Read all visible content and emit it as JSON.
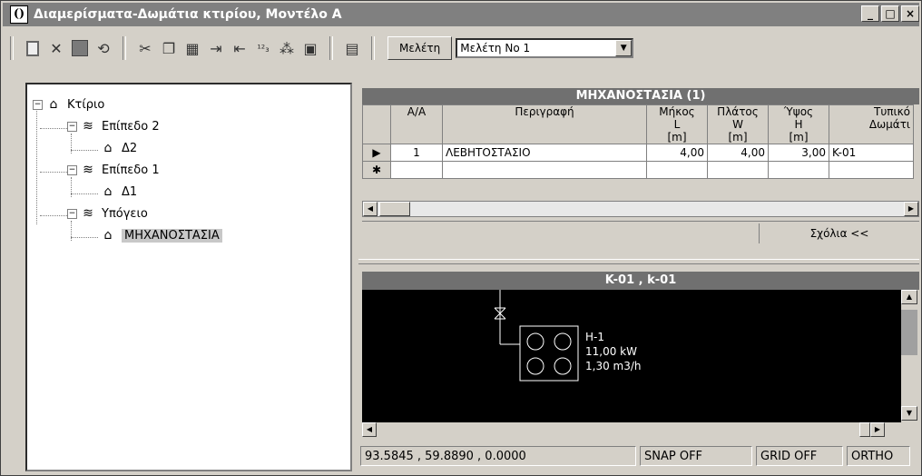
{
  "window": {
    "app_icon": "()",
    "title": "Διαμερίσματα-Δωμάτια κτιρίου, Μοντέλο Α",
    "controls": [
      "_",
      "□",
      "×"
    ]
  },
  "toolbar": {
    "icons": [
      "new-icon",
      "delete-icon",
      "stop-icon",
      "refresh-icon",
      "cut-icon",
      "copy-icon",
      "paste-icon",
      "insert-right-icon",
      "insert-left-icon",
      "numbering-icon",
      "tree-icon",
      "image-icon",
      "table-icon"
    ],
    "meleti_button": "Μελέτη",
    "meleti_select": "Μελέτη No 1"
  },
  "tree": {
    "root": "Κτίριο",
    "nodes": [
      {
        "label": "Επίπεδο 2",
        "child": "Δ2"
      },
      {
        "label": "Επίπεδο 1",
        "child": "Δ1"
      },
      {
        "label": "Υπόγειο",
        "child": "ΜΗΧΑΝΟΣΤΑΣΙΑ"
      }
    ]
  },
  "grid": {
    "title": "ΜΗΧΑΝΟΣΤΑΣΙΑ (1)",
    "columns": [
      {
        "l1": "Α/Α",
        "l2": "",
        "l3": ""
      },
      {
        "l1": "Περιγραφή",
        "l2": "",
        "l3": ""
      },
      {
        "l1": "Μήκος",
        "l2": "L",
        "l3": "[m]"
      },
      {
        "l1": "Πλάτος",
        "l2": "W",
        "l3": "[m]"
      },
      {
        "l1": "Ύψος",
        "l2": "H",
        "l3": "[m]"
      },
      {
        "l1": "Τυπικό",
        "l2": "Δωμάτι",
        "l3": ""
      }
    ],
    "rows": [
      {
        "aa": "1",
        "desc": "ΛΕΒΗΤΟΣΤΑΣΙΟ",
        "length": "4,00",
        "width": "4,00",
        "height": "3,00",
        "type": "K-01"
      }
    ],
    "new_row_marker": "✱",
    "comments_button": "Σχόλια <<"
  },
  "cad": {
    "title": "K-01 , k-01",
    "equipment_label": "H-1",
    "power": "11,00 kW",
    "flow": "1,30 m3/h"
  },
  "status": {
    "coords": "93.5845 , 59.8890 , 0.0000",
    "snap": "SNAP OFF",
    "grid": "GRID OFF",
    "ortho": "ORTHO"
  }
}
